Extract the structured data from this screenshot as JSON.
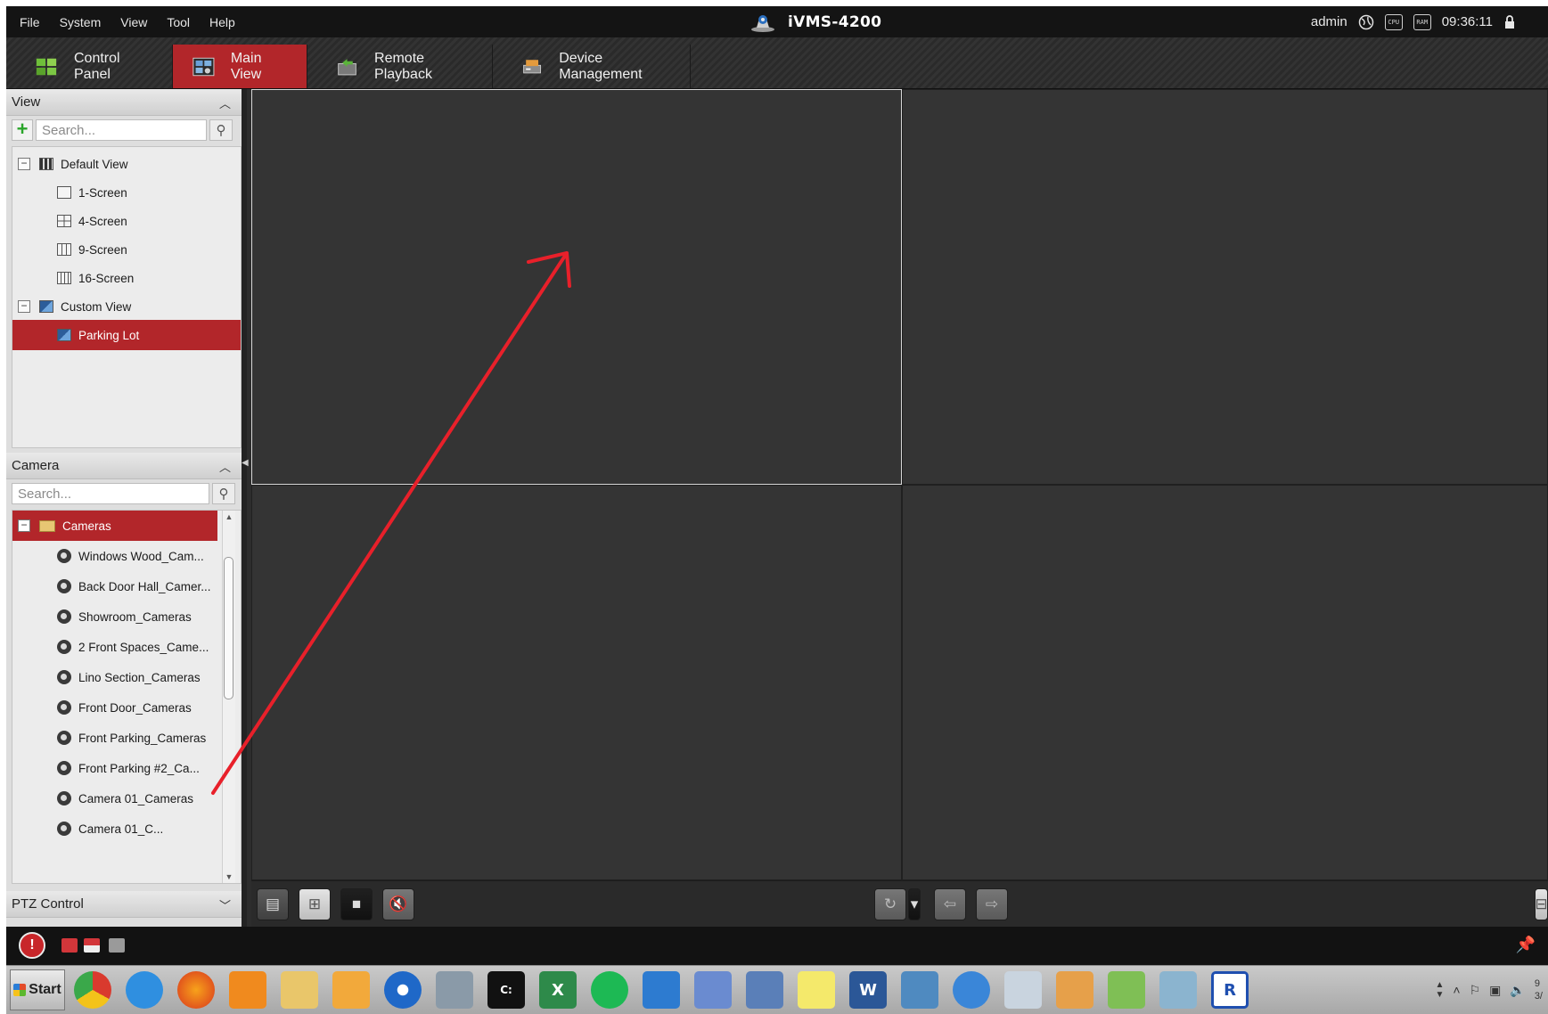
{
  "menu": [
    "File",
    "System",
    "View",
    "Tool",
    "Help"
  ],
  "app": {
    "title": "iVMS-4200",
    "user": "admin",
    "time": "09:36:11",
    "cpu_label": "CPU",
    "ram_label": "RAM"
  },
  "tabs": [
    {
      "label": "Control Panel",
      "active": false,
      "icon": "control-panel-icon"
    },
    {
      "label": "Main View",
      "active": true,
      "icon": "main-view-icon"
    },
    {
      "label": "Remote Playback",
      "active": false,
      "icon": "remote-playback-icon"
    },
    {
      "label": "Device Management",
      "active": false,
      "icon": "device-management-icon"
    }
  ],
  "view_panel": {
    "title": "View",
    "search_placeholder": "Search...",
    "tree": [
      {
        "label": "Default View",
        "level": 0,
        "expander": "−",
        "icon": "default-view-icon"
      },
      {
        "label": "1-Screen",
        "level": 1,
        "icon": "1-screen-icon"
      },
      {
        "label": "4-Screen",
        "level": 1,
        "icon": "4-screen-icon"
      },
      {
        "label": "9-Screen",
        "level": 1,
        "icon": "9-screen-icon"
      },
      {
        "label": "16-Screen",
        "level": 1,
        "icon": "16-screen-icon"
      },
      {
        "label": "Custom View",
        "level": 0,
        "expander": "−",
        "icon": "custom-view-icon"
      },
      {
        "label": "Parking Lot",
        "level": 1,
        "selected": true,
        "icon": "custom-view-icon"
      }
    ]
  },
  "camera_panel": {
    "title": "Camera",
    "search_placeholder": "Search...",
    "root": {
      "label": "Cameras",
      "expander": "−",
      "selected": true
    },
    "cameras": [
      "Windows Wood_Cam...",
      "Back Door Hall_Camer...",
      "Showroom_Cameras",
      "2 Front Spaces_Came...",
      "Lino Section_Cameras",
      "Front Door_Cameras",
      "Front Parking_Cameras",
      "Front Parking #2_Ca...",
      "Camera 01_Cameras",
      "Camera 01_C..."
    ]
  },
  "ptz_panel": {
    "title": "PTZ Control"
  },
  "annotation": {
    "color": "#e8202a"
  },
  "colors": {
    "accent": "#b2262a",
    "background": "#2d2d2d"
  },
  "taskbar": {
    "start_label": "Start",
    "apps": [
      "chrome-icon",
      "ie-icon",
      "firefox-icon",
      "media-player-icon",
      "file-explorer-icon",
      "outlook-icon",
      "ivms-icon",
      "secure-quick-icon",
      "cmd-icon",
      "excel-icon",
      "spotify-icon",
      "teamviewer-icon",
      "network-icon",
      "remote-desktop-icon",
      "sticky-notes-icon",
      "word-icon",
      "photo-viewer-icon",
      "magnifier-icon",
      "calculator-icon",
      "paint-icon",
      "notepad-icon",
      "eraser-icon",
      "r-icon"
    ],
    "tray_time": "9",
    "tray_date": "3/"
  }
}
